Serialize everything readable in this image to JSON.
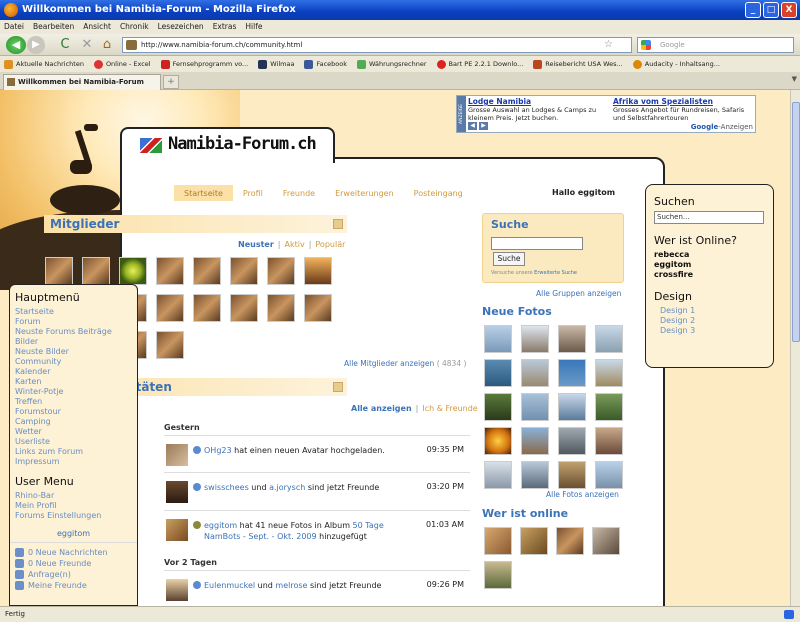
{
  "window": {
    "title": "Willkommen bei Namibia-Forum - Mozilla Firefox",
    "min": "_",
    "max": "□",
    "close": "X"
  },
  "menu": [
    "Datei",
    "Bearbeiten",
    "Ansicht",
    "Chronik",
    "Lesezeichen",
    "Extras",
    "Hilfe"
  ],
  "nav": {
    "url": "http://www.namibia-forum.ch/community.html",
    "search_placeholder": "Google",
    "back": "◀",
    "fwd": "▶",
    "reload": "C",
    "stop": "✕",
    "home": "⌂"
  },
  "bookmarks": [
    "Aktuelle Nachrichten",
    "Online - Excel",
    "Fernsehprogramm vo...",
    "Wilmaa",
    "Facebook",
    "Währungsrechner",
    "Bart PE 2.2.1 Downlo...",
    "Reisebericht USA Wes...",
    "Audacity - Inhaltsang..."
  ],
  "tab": {
    "label": "Willkommen bei Namibia-Forum",
    "plus": "+"
  },
  "ad": {
    "tag": "ANZEIGE",
    "items": [
      {
        "title": "Lodge Namibia",
        "text": "Grosse Auswahl an Lodges & Camps zu kleinem Preis. Jetzt buchen."
      },
      {
        "title": "Afrika vom Spezialisten",
        "text": "Grosses Angebot für Rundreisen, Safaris und Selbstfahrertouren"
      }
    ],
    "google": "Google",
    "google_sub": "-Anzeigen"
  },
  "site": {
    "logo": "Namibia-Forum.ch"
  },
  "mainnav": [
    "Startseite",
    "Profil",
    "Freunde",
    "Erweiterungen",
    "Posteingang"
  ],
  "greeting": "Hallo eggitom",
  "members": {
    "title": "Mitglieder",
    "filters": [
      "Neuster",
      "Aktiv",
      "Populär"
    ],
    "show_all": "Alle Mitglieder anzeigen",
    "count": "( 4834 )"
  },
  "activities": {
    "title": "Letzte Aktivitäten",
    "filters": [
      "Alle anzeigen",
      "Ich & Freunde"
    ],
    "day1": "Gestern",
    "day2": "Vor 2 Tagen",
    "items": [
      {
        "user": "OHg23",
        "text": "hat einen neuen Avatar hochgeladen.",
        "time": "09:35 PM"
      },
      {
        "user": "swisschees",
        "mid": "und",
        "user2": "a.jorysch",
        "text": "sind jetzt Freunde",
        "time": "03:20 PM"
      },
      {
        "user": "eggitom",
        "text": "hat 41 neue Fotos in Album",
        "album": "50 Tage NamBots - Sept. - Okt. 2009",
        "tail": "hinzugefügt",
        "time": "01:03 AM"
      },
      {
        "user": "Eulenmuckel",
        "mid": "und",
        "user2": "melrose",
        "text": "sind jetzt Freunde",
        "time": "09:26 PM"
      }
    ]
  },
  "search": {
    "title": "Suche",
    "button": "Suche",
    "note": "Versuche unsere",
    "note_link": "Erweiterte Suche"
  },
  "groups_link": "Alle Gruppen anzeigen",
  "photos": {
    "title": "Neue Fotos",
    "show_all": "Alle Fotos anzeigen"
  },
  "who_online": {
    "title": "Wer ist online"
  },
  "sidebar": {
    "main_title": "Hauptmenü",
    "main_items": [
      "Startseite",
      "Forum",
      "Neuste Forums Beiträge",
      "Bilder",
      "Neuste Bilder",
      "Community",
      "Kalender",
      "Karten",
      "Winter-Potje",
      "Treffen",
      "Forumstour",
      "Camping",
      "Wetter",
      "Userliste",
      "Links zum Forum",
      "Impressum"
    ],
    "user_title": "User Menu",
    "user_items": [
      "Rhino-Bar",
      "Mein Profil",
      "Forums Einstellungen"
    ],
    "username": "eggitom",
    "stats": [
      "0 Neue Nachrichten",
      "0 Neue Freunde",
      "Anfrage(n)",
      "Meine Freunde"
    ]
  },
  "rightbox": {
    "suchen": "Suchen",
    "suchen_ph": "Suchen...",
    "online_title": "Wer ist Online?",
    "online": [
      "rebecca",
      "eggitom",
      "crossfire"
    ],
    "design_title": "Design",
    "designs": [
      "Design 1",
      "Design 2",
      "Design 3"
    ]
  },
  "status": "Fertig"
}
